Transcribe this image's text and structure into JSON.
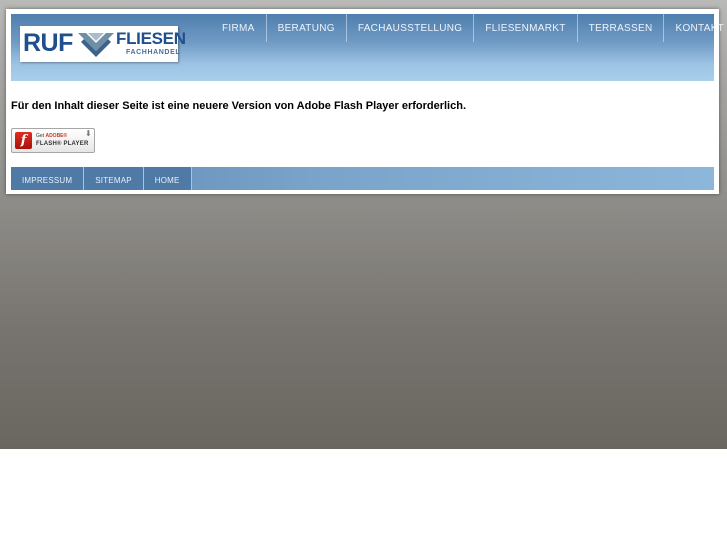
{
  "logo": {
    "brand_left": "RUF",
    "brand_right": "FLIESEN",
    "brand_sub": "FACHHANDEL"
  },
  "topnav": [
    {
      "label": "FIRMA"
    },
    {
      "label": "BERATUNG"
    },
    {
      "label": "FACHAUSSTELLUNG"
    },
    {
      "label": "FLIESENMARKT"
    },
    {
      "label": "TERRASSEN"
    },
    {
      "label": "KONTAKT"
    }
  ],
  "content": {
    "flash_message": "Für den Inhalt dieser Seite ist eine neuere Version von Adobe Flash Player erforderlich."
  },
  "flash_badge": {
    "line1_prefix": "Get",
    "line1_brand": "ADOBE®",
    "line2": "FLASH® PLAYER",
    "icon": "flash-player-icon"
  },
  "footer_nav": [
    {
      "label": "IMPRESSUM"
    },
    {
      "label": "SITEMAP"
    },
    {
      "label": "HOME"
    }
  ],
  "colors": {
    "brand_blue": "#1f4f8d",
    "header_blue": "#6f9ac4",
    "footer_blue": "#7aa3c9",
    "flash_red": "#c0392b"
  }
}
